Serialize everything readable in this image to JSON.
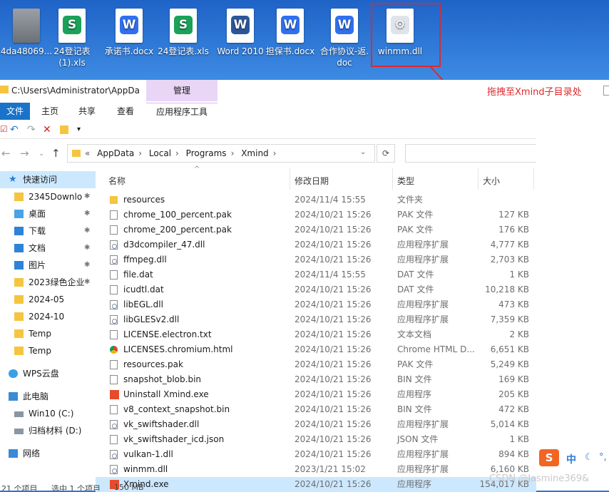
{
  "desktop": {
    "icons": [
      {
        "label": "4da48069...",
        "kind": "gray"
      },
      {
        "label": "24登记表\n(1).xls",
        "kind": "s",
        "glyph": "S"
      },
      {
        "label": "承诺书.docx",
        "kind": "w",
        "glyph": "W"
      },
      {
        "label": "24登记表.xls",
        "kind": "s",
        "glyph": "S"
      },
      {
        "label": "Word 2010",
        "kind": "word",
        "glyph": "W"
      },
      {
        "label": "担保书.docx",
        "kind": "w",
        "glyph": "W"
      },
      {
        "label": "合作协议-返.\ndoc",
        "kind": "w",
        "glyph": "W"
      },
      {
        "label": "winmm.dll",
        "kind": "gear",
        "glyph": "⚙"
      }
    ],
    "annotation": "拖拽至Xmind子目录处"
  },
  "window": {
    "title_path": "C:\\Users\\Administrator\\AppDa",
    "manage_tab": "管理",
    "tabs": {
      "file": "文件",
      "home": "主页",
      "share": "共享",
      "view": "查看",
      "apptools": "应用程序工具"
    },
    "breadcrumb": [
      "AppData",
      "Local",
      "Programs",
      "Xmind"
    ],
    "breadcrumb_lead": "«"
  },
  "nav": {
    "items": [
      {
        "label": "快速访问",
        "icon": "star",
        "sel": true
      },
      {
        "label": "2345Downlo",
        "icon": "folder",
        "pin": true
      },
      {
        "label": "桌面",
        "icon": "desk",
        "pin": true
      },
      {
        "label": "下载",
        "icon": "blue",
        "pin": true
      },
      {
        "label": "文档",
        "icon": "blue",
        "pin": true
      },
      {
        "label": "图片",
        "icon": "blue",
        "pin": true
      },
      {
        "label": "2023绿色企业",
        "icon": "folder",
        "pin": true
      },
      {
        "label": "2024-05",
        "icon": "folder"
      },
      {
        "label": "2024-10",
        "icon": "folder"
      },
      {
        "label": "Temp",
        "icon": "folder"
      },
      {
        "label": "Temp",
        "icon": "folder"
      },
      {
        "label": "WPS云盘",
        "icon": "cloud"
      },
      {
        "label": "此电脑",
        "icon": "pc"
      },
      {
        "label": "Win10 (C:)",
        "icon": "drive"
      },
      {
        "label": "归档材料 (D:)",
        "icon": "drive"
      },
      {
        "label": "网络",
        "icon": "net"
      }
    ]
  },
  "columns": {
    "name": "名称",
    "date": "修改日期",
    "type": "类型",
    "size": "大小"
  },
  "files": [
    {
      "name": "resources",
      "date": "2024/11/4 15:55",
      "type": "文件夹",
      "size": "",
      "icon": "folder"
    },
    {
      "name": "chrome_100_percent.pak",
      "date": "2024/10/21 15:26",
      "type": "PAK 文件",
      "size": "127 KB",
      "icon": "file"
    },
    {
      "name": "chrome_200_percent.pak",
      "date": "2024/10/21 15:26",
      "type": "PAK 文件",
      "size": "176 KB",
      "icon": "file"
    },
    {
      "name": "d3dcompiler_47.dll",
      "date": "2024/10/21 15:26",
      "type": "应用程序扩展",
      "size": "4,777 KB",
      "icon": "dll"
    },
    {
      "name": "ffmpeg.dll",
      "date": "2024/10/21 15:26",
      "type": "应用程序扩展",
      "size": "2,703 KB",
      "icon": "dll"
    },
    {
      "name": "file.dat",
      "date": "2024/11/4 15:55",
      "type": "DAT 文件",
      "size": "1 KB",
      "icon": "file"
    },
    {
      "name": "icudtl.dat",
      "date": "2024/10/21 15:26",
      "type": "DAT 文件",
      "size": "10,218 KB",
      "icon": "file"
    },
    {
      "name": "libEGL.dll",
      "date": "2024/10/21 15:26",
      "type": "应用程序扩展",
      "size": "473 KB",
      "icon": "dll"
    },
    {
      "name": "libGLESv2.dll",
      "date": "2024/10/21 15:26",
      "type": "应用程序扩展",
      "size": "7,359 KB",
      "icon": "dll"
    },
    {
      "name": "LICENSE.electron.txt",
      "date": "2024/10/21 15:26",
      "type": "文本文档",
      "size": "2 KB",
      "icon": "file"
    },
    {
      "name": "LICENSES.chromium.html",
      "date": "2024/10/21 15:26",
      "type": "Chrome HTML D...",
      "size": "6,651 KB",
      "icon": "chrome"
    },
    {
      "name": "resources.pak",
      "date": "2024/10/21 15:26",
      "type": "PAK 文件",
      "size": "5,249 KB",
      "icon": "file"
    },
    {
      "name": "snapshot_blob.bin",
      "date": "2024/10/21 15:26",
      "type": "BIN 文件",
      "size": "169 KB",
      "icon": "file"
    },
    {
      "name": "Uninstall Xmind.exe",
      "date": "2024/10/21 15:26",
      "type": "应用程序",
      "size": "205 KB",
      "icon": "xmind"
    },
    {
      "name": "v8_context_snapshot.bin",
      "date": "2024/10/21 15:26",
      "type": "BIN 文件",
      "size": "472 KB",
      "icon": "file"
    },
    {
      "name": "vk_swiftshader.dll",
      "date": "2024/10/21 15:26",
      "type": "应用程序扩展",
      "size": "5,014 KB",
      "icon": "dll"
    },
    {
      "name": "vk_swiftshader_icd.json",
      "date": "2024/10/21 15:26",
      "type": "JSON 文件",
      "size": "1 KB",
      "icon": "file"
    },
    {
      "name": "vulkan-1.dll",
      "date": "2024/10/21 15:26",
      "type": "应用程序扩展",
      "size": "894 KB",
      "icon": "dll"
    },
    {
      "name": "winmm.dll",
      "date": "2023/1/21 15:02",
      "type": "应用程序扩展",
      "size": "6,160 KB",
      "icon": "dll"
    },
    {
      "name": "Xmind.exe",
      "date": "2024/10/21 15:26",
      "type": "应用程序",
      "size": "154,017 KB",
      "icon": "xmind",
      "sel": true
    }
  ],
  "status": {
    "items": "21 个项目",
    "selected": "选中 1 个项目",
    "size": "150 MB"
  },
  "ime": {
    "logo": "S",
    "lang": "中",
    "moon": "☾",
    "dot": "°,"
  },
  "watermark": "CSDN @Jasmine369&",
  "colors": {
    "accent": "#1a73c8",
    "highlight": "#e0282a",
    "selection": "#cce8ff",
    "manage_tab": "#e9d6f7"
  }
}
